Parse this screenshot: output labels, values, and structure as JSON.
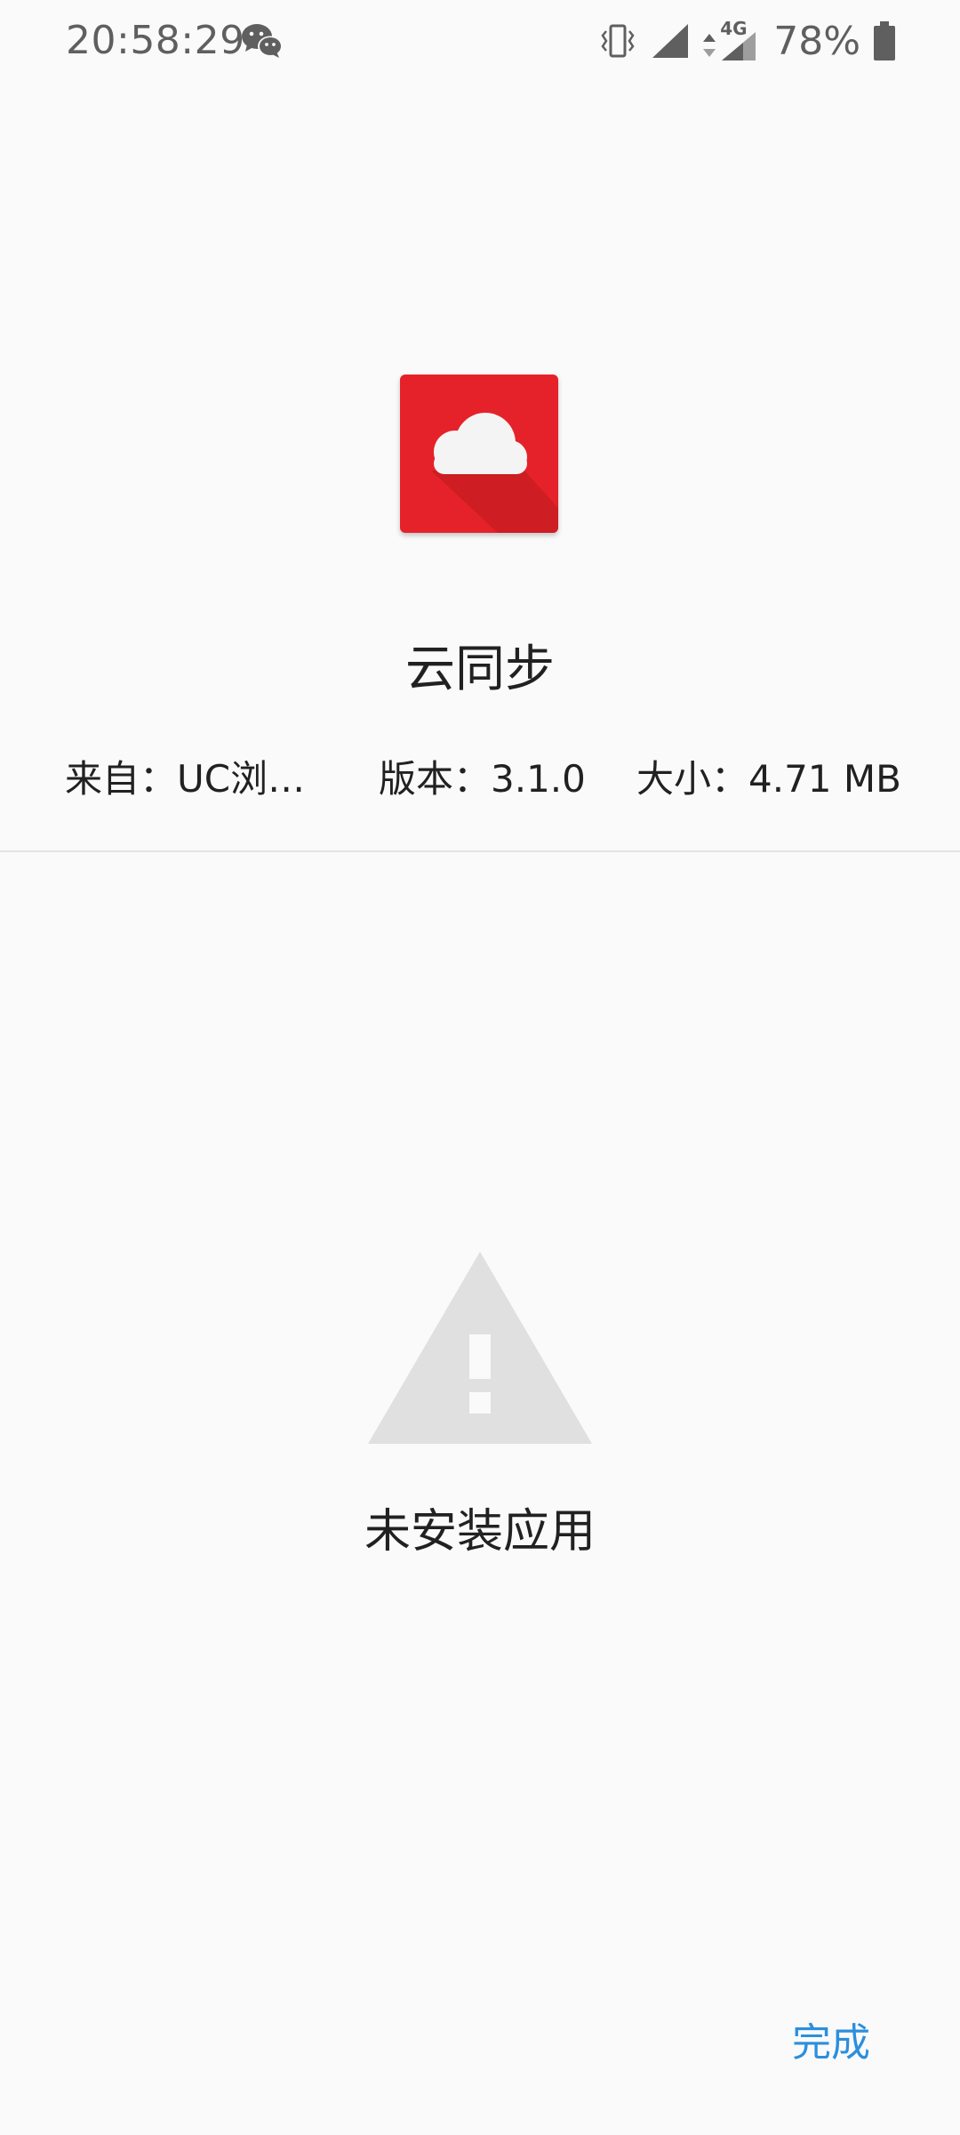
{
  "status_bar": {
    "time": "20:58:29",
    "battery_percent": "78%",
    "network_label": "4G",
    "icons": [
      "wechat-icon",
      "vibrate-icon",
      "signal-icon",
      "data-arrows-icon",
      "signal-4g-icon",
      "battery-icon"
    ]
  },
  "app": {
    "name": "云同步",
    "icon": "cloud-icon",
    "source": "来自：UC浏…",
    "version": "版本：3.1.0",
    "size": "大小：4.71 MB"
  },
  "install_status": {
    "icon": "warning-icon",
    "message": "未安装应用"
  },
  "actions": {
    "done_label": "完成"
  },
  "colors": {
    "app_icon_background": "#e5222a",
    "accent": "#2b8fde",
    "warning_icon": "#e0e0e0",
    "background": "#fafafa"
  }
}
